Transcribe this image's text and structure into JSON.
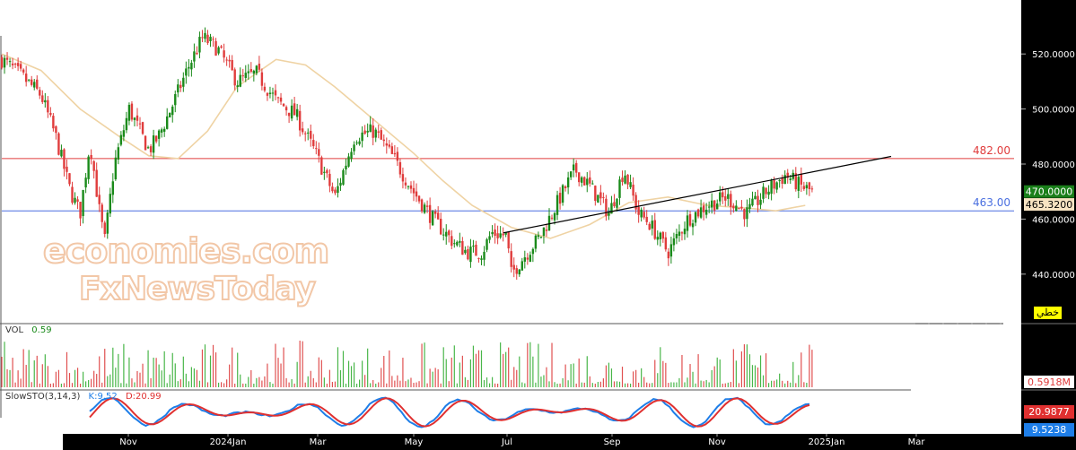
{
  "chart_data": {
    "type": "candlestick",
    "price_axis": {
      "ylim": [
        423,
        537
      ],
      "ticks": [
        440,
        460,
        480,
        500,
        520
      ],
      "tick_labels": [
        "440.0000",
        "460.0000",
        "480.0000",
        "500.0000",
        "520.0000"
      ]
    },
    "time_axis": {
      "labels": [
        "Nov",
        "2024Jan",
        "Mar",
        "May",
        "Jul",
        "Sep",
        "Nov",
        "2025Jan",
        "Mar"
      ]
    },
    "horizontal_lines": [
      {
        "label": "482.00",
        "value": 482,
        "color": "#e03c3c"
      },
      {
        "label": "463.00",
        "value": 463,
        "color": "#4a6fe0"
      }
    ],
    "trendline": {
      "from": [
        0.512,
        455
      ],
      "to": [
        0.827,
        473
      ],
      "note": "uses normalized time fraction 0-1 and price"
    },
    "moving_average": {
      "color": "#efd3a4",
      "x": [
        0.0,
        0.04,
        0.08,
        0.12,
        0.15,
        0.18,
        0.21,
        0.24,
        0.28,
        0.31,
        0.34,
        0.38,
        0.42,
        0.45,
        0.48,
        0.52,
        0.56,
        0.6,
        0.64,
        0.68,
        0.72,
        0.76,
        0.79,
        0.82
      ],
      "y": [
        520,
        514,
        500,
        490,
        483,
        482,
        492,
        508,
        518,
        516,
        508,
        496,
        484,
        474,
        465,
        457,
        453,
        458,
        466,
        468,
        465,
        464,
        463,
        465
      ]
    },
    "price_series": {
      "x": [
        0.0,
        0.02,
        0.04,
        0.055,
        0.07,
        0.08,
        0.09,
        0.1,
        0.105,
        0.115,
        0.13,
        0.15,
        0.16,
        0.175,
        0.19,
        0.205,
        0.22,
        0.24,
        0.26,
        0.28,
        0.3,
        0.32,
        0.34,
        0.36,
        0.38,
        0.4,
        0.42,
        0.44,
        0.46,
        0.475,
        0.49,
        0.5,
        0.515,
        0.52,
        0.53,
        0.55,
        0.57,
        0.585,
        0.6,
        0.62,
        0.635,
        0.65,
        0.66,
        0.68,
        0.7,
        0.72,
        0.74,
        0.76,
        0.78,
        0.8,
        0.815,
        0.827
      ],
      "y": [
        518,
        512,
        505,
        490,
        470,
        462,
        488,
        462,
        452,
        480,
        500,
        485,
        490,
        502,
        515,
        526,
        522,
        510,
        513,
        503,
        498,
        484,
        468,
        490,
        492,
        482,
        470,
        460,
        452,
        448,
        448,
        455,
        454,
        440,
        445,
        454,
        468,
        478,
        472,
        462,
        478,
        462,
        459,
        448,
        460,
        465,
        468,
        462,
        470,
        476,
        472,
        470
      ]
    },
    "price_tags": [
      {
        "label": "470.0000",
        "value": 470,
        "bg": "#1a7f1a",
        "fg": "#ffffff"
      },
      {
        "label": "465.3200",
        "value": 465.32,
        "bg": "#f7e3c2",
        "fg": "#000000"
      }
    ],
    "volume_panel": {
      "indicator_name": "VOL",
      "indicator_value": "0.59",
      "tag_label": "0.5918M",
      "tag_bg": "#ffffff",
      "tag_fg": "#e03c3c",
      "scale_max": 2.4
    },
    "stochastic_panel": {
      "indicator_name": "SlowSTO(3,14,3)",
      "k_label": "K:9.52",
      "d_label": "D:20.99",
      "k_color": "#1e7ee8",
      "d_color": "#e03030",
      "tags": [
        {
          "label": "20.9877",
          "bg": "#e03030",
          "fg": "#ffffff"
        },
        {
          "label": "9.5238",
          "bg": "#1e7ee8",
          "fg": "#ffffff"
        }
      ]
    },
    "drawing_mode_badge": {
      "label": "خطي",
      "bg": "#ffff00"
    },
    "up_color": "#1a8a1a",
    "down_color": "#e03c3c",
    "watermark": [
      "economies.com",
      "FxNewsToday"
    ]
  }
}
